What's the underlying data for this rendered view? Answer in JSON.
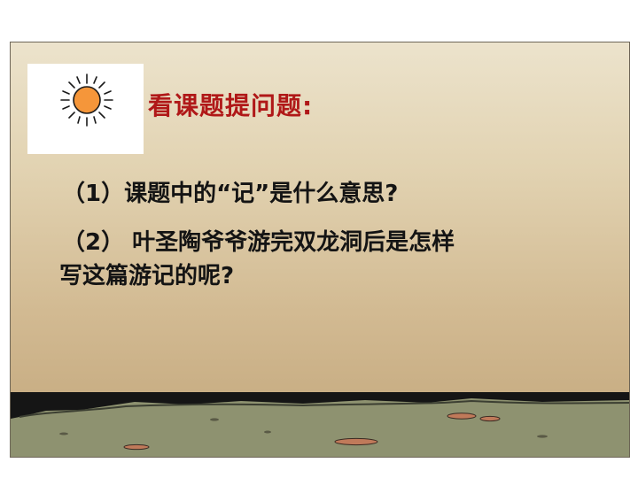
{
  "slide": {
    "title": "看课题提问题:",
    "questions": [
      "（1）课题中的“记”是什么意思?",
      "（2） 叶圣陶爷爷游完双龙洞后是怎样",
      "写这篇游记的呢?"
    ],
    "sun_icon": "sun-icon",
    "colors": {
      "title": "#b01818",
      "text": "#141414",
      "sun": "#f5963a",
      "ground": "#8e9270",
      "background_top": "#ece3cc",
      "background_bottom": "#c2a67b"
    }
  }
}
